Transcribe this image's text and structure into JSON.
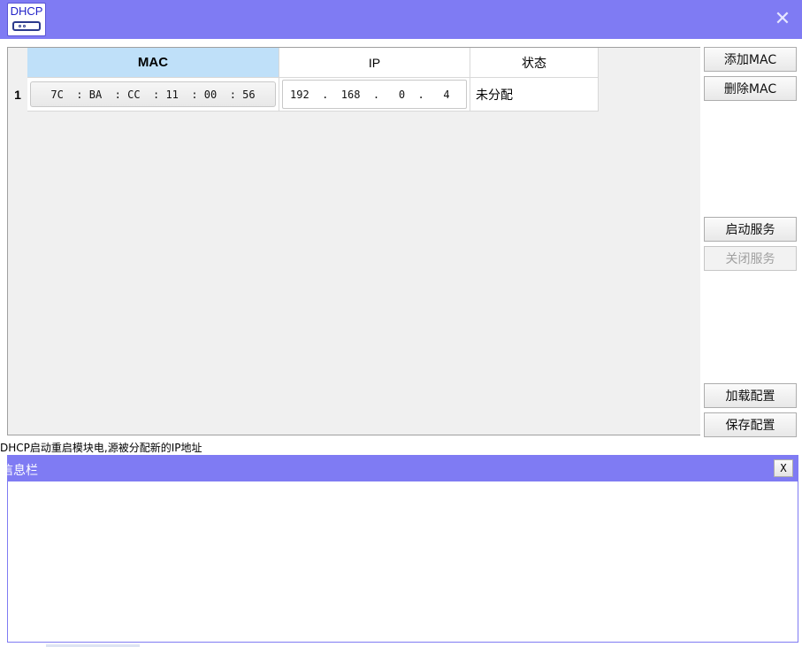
{
  "window": {
    "title": "DHCP",
    "close_glyph": "✕",
    "icon": "dhcp-device-icon"
  },
  "table": {
    "columns": [
      "MAC",
      "IP",
      "状态"
    ],
    "rows": [
      {
        "index": "1",
        "mac": "7C  : BA  : CC  : 11  : 00  : 56",
        "ip": "192  .  168  .   0  .   4",
        "status": "未分配"
      }
    ]
  },
  "buttons": {
    "add_mac": "添加MAC",
    "delete_mac": "删除MAC",
    "start_service": "启动服务",
    "stop_service": "关闭服务",
    "load_config": "加载配置",
    "save_config": "保存配置"
  },
  "status_line": "DHCP启动重启模块电,源被分配新的IP地址",
  "info_panel": {
    "title": "信息栏",
    "close_label": "X",
    "content": ""
  },
  "colors": {
    "title_bar": "#7f7bf3",
    "header_selected": "#bfe0f9"
  }
}
